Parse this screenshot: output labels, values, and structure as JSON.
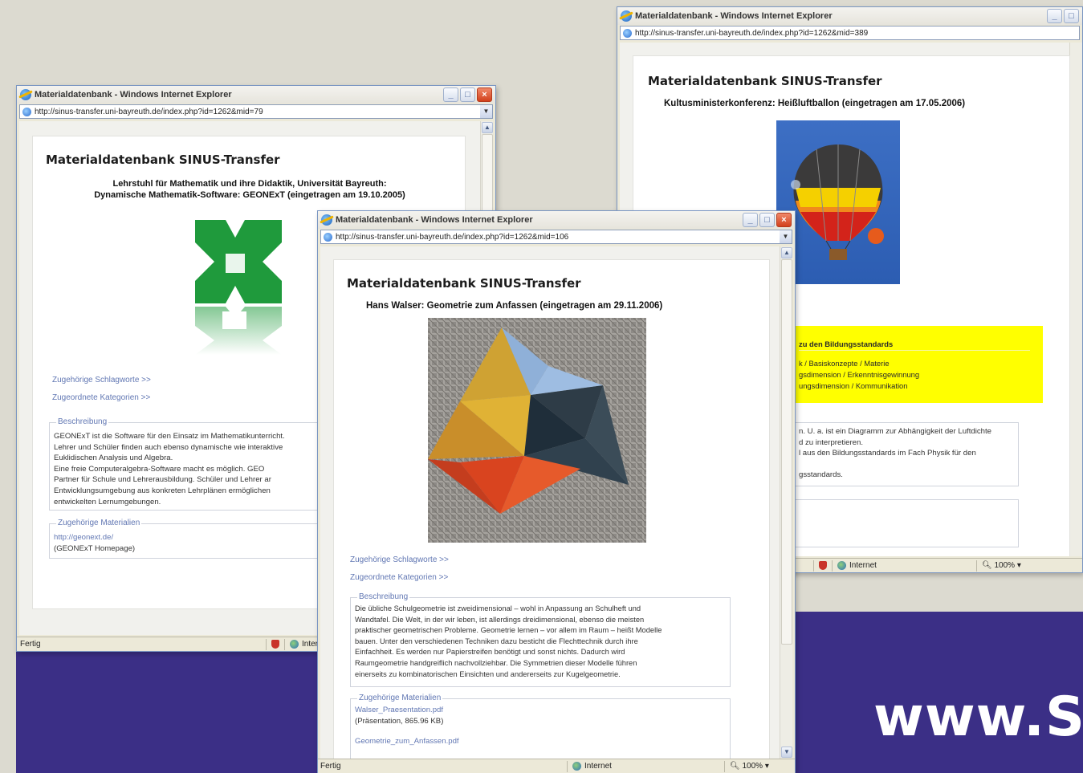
{
  "branding": {
    "url_text": "www.S"
  },
  "window_left": {
    "title": "Materialdatenbank - Windows Internet Explorer",
    "address": "http://sinus-transfer.uni-bayreuth.de/index.php?id=1262&mid=79",
    "site_title": "Materialdatenbank SINUS-Transfer",
    "entry_line1": "Lehrstuhl für Mathematik und ihre Didaktik, Universität Bayreuth:",
    "entry_line2": "Dynamische Mathematik-Software: GEONExT (eingetragen am 19.10.2005)",
    "link_keywords": "Zugehörige Schlagworte >>",
    "link_categories": "Zugeordnete Kategorien >>",
    "description_legend": "Beschreibung",
    "description_lines": [
      "GEONExT ist die Software für den Einsatz im Mathematikunterricht.",
      "Lehrer und Schüler finden auch ebenso dynamische wie interaktive",
      "Euklidischen Analysis und Algebra.",
      "Eine freie Computeralgebra-Software macht es möglich. GEO",
      "Partner für Schule und Lehrerausbildung. Schüler und Lehrer ar",
      "Entwicklungsumgebung aus konkreten Lehrplänen ermöglichen",
      "entwickelten Lernumgebungen."
    ],
    "materials_legend": "Zugehörige Materialien",
    "materials_lines": [
      "http://geonext.de/",
      "(GEONExT Homepage)"
    ],
    "status": "Fertig",
    "zone": "Internet",
    "colors": {
      "logo_green": "#1f9a3c"
    }
  },
  "window_right": {
    "title": "Materialdatenbank - Windows Internet Explorer",
    "address": "http://sinus-transfer.uni-bayreuth.de/index.php?id=1262&mid=389",
    "site_title": "Materialdatenbank SINUS-Transfer",
    "entry_line": "Kultusministerkonferenz: Heißluftballon (eingetragen am 17.05.2006)",
    "yellow_title": "zu den Bildungsstandards",
    "yellow_lines": [
      "k / Basiskonzepte / Materie",
      "gsdimension / Erkenntnisgewinnung",
      "ungsdimension / Kommunikation"
    ],
    "description_lines": [
      "n. U. a. ist ein Diagramm zur Abhängigkeit der Luftdichte",
      "d zu interpretieren.",
      "l aus den Bildungsstandards im Fach Physik für den",
      "",
      "gsstandards."
    ],
    "zone": "Internet",
    "zoom": "100%",
    "colors": {
      "highlight": "#ffff00"
    }
  },
  "window_front": {
    "title": "Materialdatenbank - Windows Internet Explorer",
    "address": "http://sinus-transfer.uni-bayreuth.de/index.php?id=1262&mid=106",
    "site_title": "Materialdatenbank SINUS-Transfer",
    "entry_line": "Hans Walser: Geometrie zum Anfassen (eingetragen am 29.11.2006)",
    "link_keywords": "Zugehörige Schlagworte >>",
    "link_categories": "Zugeordnete Kategorien >>",
    "description_legend": "Beschreibung",
    "description_lines": [
      "Die übliche Schulgeometrie ist zweidimensional – wohl in Anpassung an Schulheft und",
      "Wandtafel. Die Welt, in der wir leben, ist allerdings dreidimensional, ebenso die meisten",
      "praktischer geometrischen Probleme. Geometrie lernen – vor allem im Raum – heißt Modelle",
      "bauen. Unter den verschiedenen Techniken dazu besticht die Flechttechnik durch ihre",
      "Einfachheit. Es werden nur Papierstreifen benötigt und sonst nichts. Dadurch wird",
      "Raumgeometrie handgreiflich nachvollziehbar. Die Symmetrien dieser Modelle führen",
      "einerseits zu kombinatorischen Einsichten und andererseits zur Kugelgeometrie."
    ],
    "materials_legend": "Zugehörige Materialien",
    "material1_link": "Walser_Praesentation.pdf",
    "material1_size": "(Präsentation, 865.96 KB)",
    "material2_link": "Geometrie_zum_Anfassen.pdf",
    "status": "Fertig",
    "zone": "Internet",
    "zoom": "100%"
  }
}
